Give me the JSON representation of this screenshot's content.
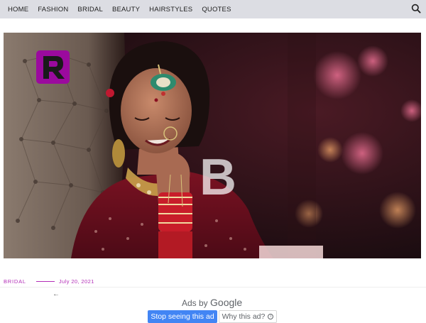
{
  "nav": {
    "items": [
      {
        "label": "HOME"
      },
      {
        "label": "FASHION"
      },
      {
        "label": "BRIDAL"
      },
      {
        "label": "BEAUTY"
      },
      {
        "label": "HAIRSTYLES"
      },
      {
        "label": "QUOTES"
      }
    ],
    "search_icon": "search-icon"
  },
  "hero": {
    "image": "bride-photo",
    "logo_letter": "R",
    "watermark_letter": "B",
    "logo_color": "#9b0a9e"
  },
  "post": {
    "category": "BRIDAL",
    "date": "July 20, 2021",
    "accent_color": "#b22cb7"
  },
  "ad": {
    "back_arrow": "←",
    "ads_by": "Ads by",
    "google": "Google",
    "stop_label": "Stop seeing this ad",
    "why_label": "Why this ad?",
    "info_icon": "info-icon",
    "stop_color": "#4285f4"
  }
}
